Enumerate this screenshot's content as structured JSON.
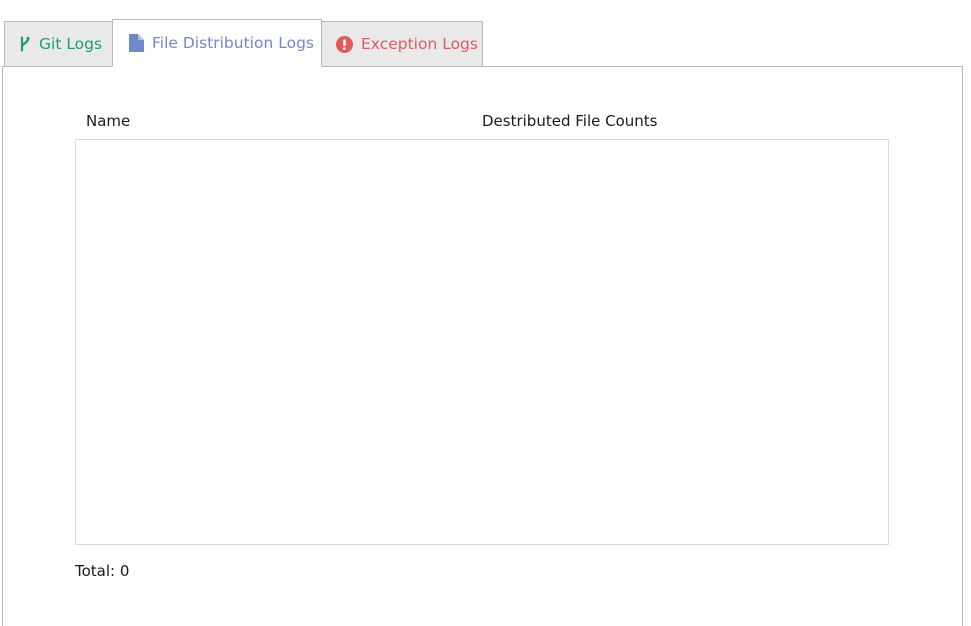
{
  "tabs": {
    "git": {
      "label": "Git Logs",
      "icon": "git-branch-icon",
      "color": "#1f9d68"
    },
    "file": {
      "label": "File Distribution Logs",
      "icon": "file-icon",
      "color": "#7289c9"
    },
    "exception": {
      "label": "Exception Logs",
      "icon": "exclamation-circle-icon",
      "color": "#e25b58"
    },
    "active": "file"
  },
  "table": {
    "columns": [
      "Name",
      "Destributed File Counts"
    ],
    "rows": []
  },
  "footer": {
    "total_label": "Total:",
    "total_value": "0"
  }
}
